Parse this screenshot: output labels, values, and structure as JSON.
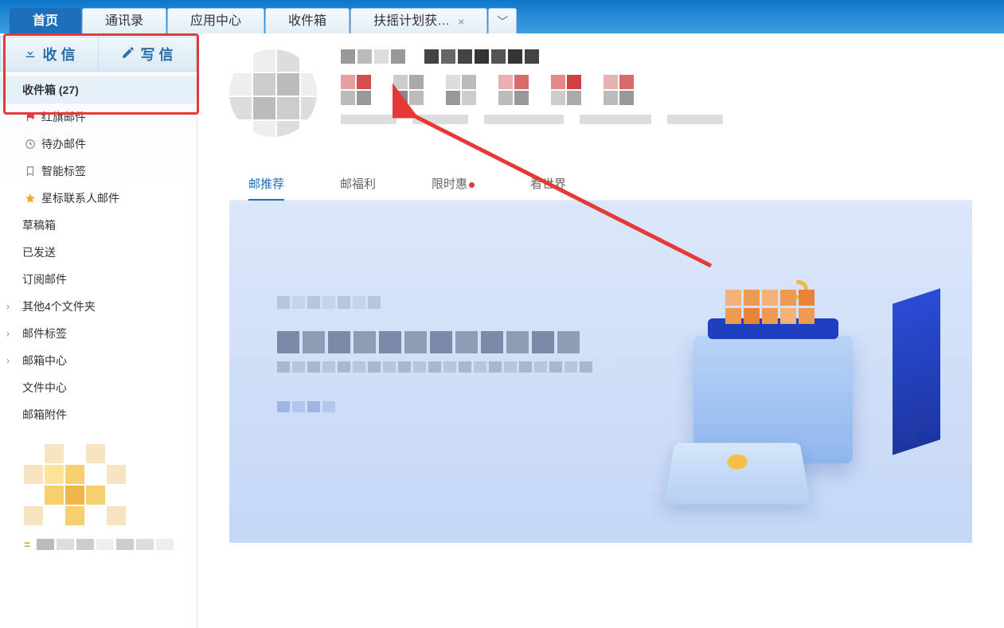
{
  "tabs": {
    "items": [
      {
        "label": "首页",
        "active": true
      },
      {
        "label": "通讯录"
      },
      {
        "label": "应用中心"
      },
      {
        "label": "收件箱"
      },
      {
        "label": "扶摇计划获…",
        "closable": true
      }
    ]
  },
  "actions": {
    "receive": {
      "label": "收 信",
      "icon": "download-icon"
    },
    "compose": {
      "label": "写 信",
      "icon": "edit-icon"
    }
  },
  "sidebar": {
    "inbox": {
      "label": "收件箱",
      "count": "(27)"
    },
    "items": [
      {
        "label": "红旗邮件",
        "icon": "flag",
        "color": "#e53935"
      },
      {
        "label": "待办邮件",
        "icon": "clock",
        "color": "#8a8a8a"
      },
      {
        "label": "智能标签",
        "icon": "bookmark",
        "color": "#8a8a8a"
      },
      {
        "label": "星标联系人邮件",
        "icon": "star",
        "color": "#f5a623"
      },
      {
        "label": "草稿箱"
      },
      {
        "label": "已发送"
      },
      {
        "label": "订阅邮件"
      },
      {
        "label": "其他4个文件夹",
        "expandable": true
      },
      {
        "label": "邮件标签",
        "expandable": true
      },
      {
        "label": "邮箱中心",
        "expandable": true
      },
      {
        "label": "文件中心"
      },
      {
        "label": "邮箱附件"
      }
    ]
  },
  "content_nav": [
    {
      "label": "邮推荐",
      "active": true
    },
    {
      "label": "邮福利"
    },
    {
      "label": "限时惠",
      "dot": true
    },
    {
      "label": "看世界"
    }
  ],
  "colors": {
    "primary": "#1b6fbd",
    "highlight": "#e53935",
    "star": "#f5a623"
  }
}
